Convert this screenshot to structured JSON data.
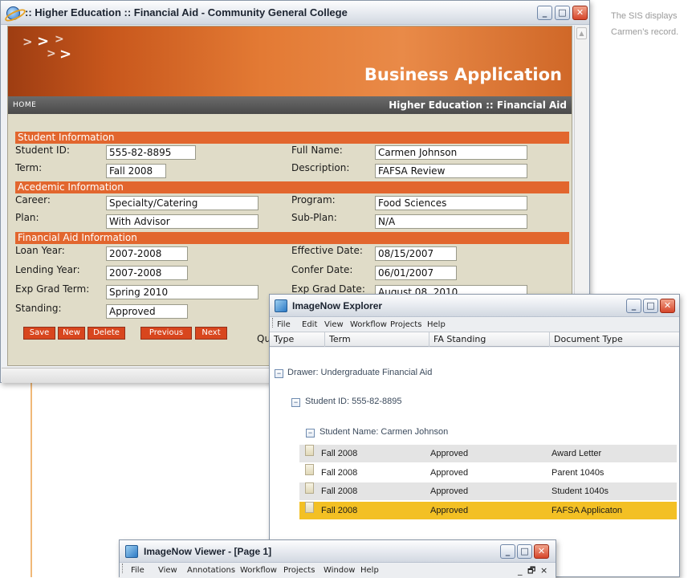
{
  "caption": {
    "line1": "The SIS displays",
    "line2": "Carmen’s record."
  },
  "browser": {
    "title": ":: Higher Education :: Financial Aid - Community General College",
    "banner_title": "Business Application",
    "nav_home": "HOME",
    "nav_section": "Higher Education :: Financial Aid",
    "sections": {
      "student": "Student Information",
      "academic": "Acedemic Information",
      "financial": "Financial Aid Information"
    },
    "fields": {
      "student_id": {
        "label": "Student ID:",
        "value": "555-82-8895"
      },
      "full_name": {
        "label": "Full Name:",
        "value": "Carmen Johnson"
      },
      "term": {
        "label": "Term:",
        "value": "Fall 2008"
      },
      "description": {
        "label": "Description:",
        "value": "FAFSA Review"
      },
      "career": {
        "label": "Career:",
        "value": "Specialty/Catering"
      },
      "program": {
        "label": "Program:",
        "value": "Food Sciences"
      },
      "plan": {
        "label": "Plan:",
        "value": "With Advisor"
      },
      "sub_plan": {
        "label": "Sub-Plan:",
        "value": "N/A"
      },
      "loan_year": {
        "label": "Loan Year:",
        "value": "2007-2008"
      },
      "effective_date": {
        "label": "Effective Date:",
        "value": "08/15/2007"
      },
      "lending_year": {
        "label": "Lending Year:",
        "value": "2007-2008"
      },
      "confer_date": {
        "label": "Confer Date:",
        "value": "06/01/2007"
      },
      "exp_grad_term": {
        "label": "Exp Grad Term:",
        "value": "Spring 2010"
      },
      "exp_grad_date": {
        "label": "Exp Grad Date:",
        "value": "August 08, 2010"
      },
      "standing": {
        "label": "Standing:",
        "value": "Approved"
      }
    },
    "buttons": {
      "save": "Save",
      "new": "New",
      "delete": "Delete",
      "previous": "Previous",
      "next": "Next"
    },
    "quick_label": "Quick"
  },
  "explorer": {
    "title": "ImageNow Explorer",
    "menu": [
      "File",
      "Edit",
      "View",
      "Workflow",
      "Projects",
      "Help"
    ],
    "columns": [
      "Type",
      "Term",
      "FA Standing",
      "Document Type"
    ],
    "tree": {
      "drawer": "Drawer: Undergraduate Financial Aid",
      "student_id": "Student ID: 555-82-8895",
      "student_name": "Student Name: Carmen Johnson"
    },
    "rows": [
      {
        "term": "Fall 2008",
        "standing": "Approved",
        "doctype": "Award Letter"
      },
      {
        "term": "Fall 2008",
        "standing": "Approved",
        "doctype": "Parent 1040s"
      },
      {
        "term": "Fall 2008",
        "standing": "Approved",
        "doctype": "Student 1040s"
      },
      {
        "term": "Fall 2008",
        "standing": "Approved",
        "doctype": "FAFSA Applicaton"
      }
    ],
    "selected_row": 3
  },
  "viewer": {
    "title": "ImageNow Viewer - [Page 1]",
    "menu": [
      "File",
      "View",
      "Annotations",
      "Workflow",
      "Projects",
      "Window",
      "Help"
    ],
    "mdi_controls": [
      "_",
      "🗗",
      "×"
    ]
  },
  "window_controls": {
    "minimize": "_",
    "maximize": "□",
    "close": "✕"
  },
  "colors": {
    "banner_orange": "#e37a34",
    "section_bar": "#e2662e",
    "button_orange": "#d8461e",
    "form_background": "#e0dcc8",
    "selected_row": "#f3c024",
    "caption_text": "#9a9a9a"
  },
  "icons": {
    "browser": "internet-explorer-icon",
    "explorer": "imagenow-icon",
    "viewer": "imagenow-icon",
    "document": "document-icon",
    "expand": "tree-collapse-icon"
  }
}
